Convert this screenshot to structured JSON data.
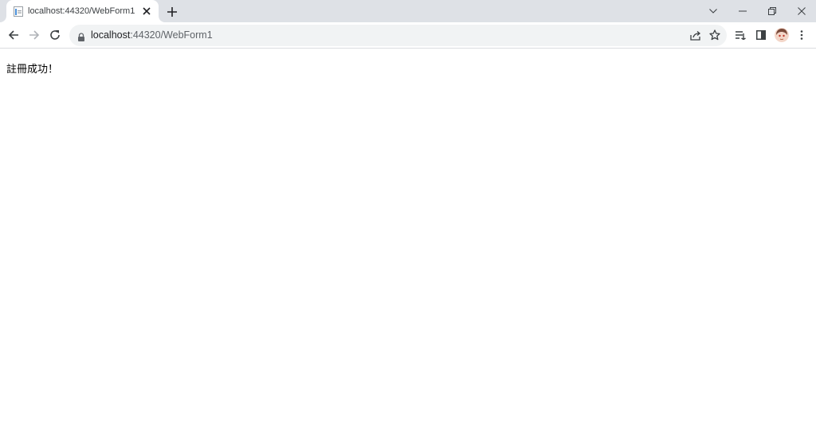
{
  "browser": {
    "tab": {
      "title": "localhost:44320/WebForm1"
    },
    "address_bar": {
      "host": "localhost",
      "rest": ":44320/WebForm1"
    }
  },
  "page": {
    "message": "註冊成功！"
  },
  "icons": {
    "back": "arrow-left-icon",
    "forward": "arrow-right-icon",
    "reload": "reload-icon",
    "lock": "lock-icon",
    "share": "share-icon",
    "bookmark": "star-icon",
    "reading_list": "reading-list-icon",
    "side_panel": "side-panel-icon",
    "menu": "kebab-menu-icon"
  },
  "colors": {
    "tab_strip": "#dee1e6",
    "omnibox": "#f1f3f4",
    "toolbar_border": "#dadce0"
  }
}
